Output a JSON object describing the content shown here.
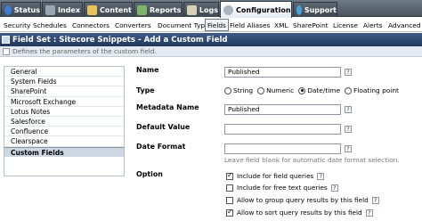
{
  "top_tabs": [
    {
      "label": "Status",
      "icon": "status-icon"
    },
    {
      "label": "Index",
      "icon": "index-icon"
    },
    {
      "label": "Content",
      "icon": "content-icon"
    },
    {
      "label": "Reports",
      "icon": "reports-icon"
    },
    {
      "label": "Logs",
      "icon": "logs-icon"
    },
    {
      "label": "Configuration",
      "icon": "configuration-icon",
      "active": true
    },
    {
      "label": "Support",
      "icon": "support-icon"
    }
  ],
  "sub_nav": [
    "Security",
    "Schedules",
    "Connectors",
    "Converters",
    "Document Types",
    "Fields",
    "Field Aliases",
    "XML",
    "SharePoint",
    "License",
    "Alerts",
    "Advanced"
  ],
  "sub_nav_active": "Fields",
  "header": {
    "title": "Field Set : Sitecore Snippets - Add a Custom Field",
    "description": "Defines the parameters of the custom field."
  },
  "left_nav": {
    "items": [
      "General",
      "System Fields",
      "SharePoint",
      "Microsoft Exchange",
      "Lotus Notes",
      "Salesforce",
      "Confluence",
      "Clearspace",
      "Custom Fields"
    ],
    "active": "Custom Fields"
  },
  "form": {
    "name_label": "Name",
    "name_value": "Published",
    "type_label": "Type",
    "type_options": [
      "String",
      "Numeric",
      "Date/time",
      "Floating point"
    ],
    "type_selected": "Date/time",
    "metadata_label": "Metadata Name",
    "metadata_value": "Published",
    "default_label": "Default Value",
    "default_value": "",
    "format_label": "Date Format",
    "format_value": "",
    "format_hint": "Leave field blank for automatic date format selection.",
    "option_label": "Option",
    "options": [
      {
        "label": "Include for field queries",
        "checked": true
      },
      {
        "label": "Include for free text queries",
        "checked": false
      },
      {
        "label": "Allow to group query results by this field",
        "checked": false
      },
      {
        "label": "Allow to sort query results by this field",
        "checked": true
      }
    ],
    "help_glyph": "?"
  },
  "colors": {
    "header_bg": "#2a4268",
    "top_bar_bg": "#5d6872",
    "active_nav_bg": "#cdd7e2"
  }
}
